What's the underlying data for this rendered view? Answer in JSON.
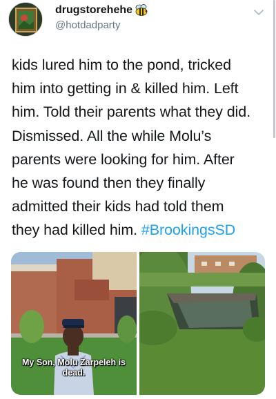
{
  "tweet": {
    "author": {
      "display_name": "drugstorehehe",
      "name_emoji_icon": "bee-icon",
      "handle": "@hotdadparty",
      "avatar_icon": "framed-picture-avatar"
    },
    "menu_icon": "chevron-down-icon",
    "text_lines": [
      "kids lured him to the pond, tricked",
      "him into getting in & killed him. Left",
      "him. Told their parents what they did.",
      "Dismissed. All the while Molu’s",
      "parents were looking for him. After",
      "he was found then they finally",
      "admitted their kids had told them",
      "they had killed him. "
    ],
    "hashtag": "#BrookingsSD",
    "colors": {
      "hashtag": "#1da1f2",
      "handle": "#657786",
      "text": "#14171a"
    },
    "media": [
      {
        "type": "photo",
        "caption_lines": [
          "My Son, Molu Zarpeleh is",
          "dead."
        ]
      },
      {
        "type": "photo"
      }
    ]
  }
}
